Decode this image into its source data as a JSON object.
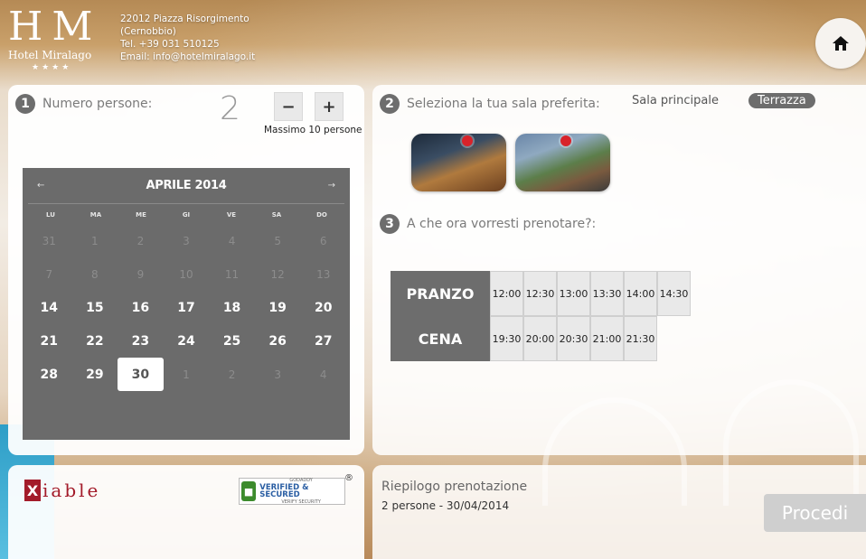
{
  "hotel": {
    "logo_mark": "H M",
    "logo_name": "Hotel Miralago",
    "logo_stars": "★★★★",
    "address_line1": "22012 Piazza Risorgimento",
    "address_line2": "(Cernobbio)",
    "phone": "Tel. +39 031 510125",
    "email": "Email: info@hotelmiralago.it"
  },
  "step1": {
    "number": "1",
    "label": "Numero persone:",
    "count": "2",
    "minus_label": "−",
    "plus_label": "+",
    "max_note": "Massimo 10 persone"
  },
  "calendar": {
    "prev_label": "←",
    "next_label": "→",
    "title": "APRILE 2014",
    "weekdays": [
      "LU",
      "MA",
      "ME",
      "GI",
      "VE",
      "SA",
      "DO"
    ],
    "days": [
      {
        "n": "31",
        "muted": true
      },
      {
        "n": "1",
        "muted": true
      },
      {
        "n": "2",
        "muted": true
      },
      {
        "n": "3",
        "muted": true
      },
      {
        "n": "4",
        "muted": true
      },
      {
        "n": "5",
        "muted": true
      },
      {
        "n": "6",
        "muted": true
      },
      {
        "n": "7",
        "muted": true
      },
      {
        "n": "8",
        "muted": true
      },
      {
        "n": "9",
        "muted": true
      },
      {
        "n": "10",
        "muted": true
      },
      {
        "n": "11",
        "muted": true
      },
      {
        "n": "12",
        "muted": true
      },
      {
        "n": "13",
        "muted": true
      },
      {
        "n": "14"
      },
      {
        "n": "15"
      },
      {
        "n": "16"
      },
      {
        "n": "17"
      },
      {
        "n": "18"
      },
      {
        "n": "19"
      },
      {
        "n": "20"
      },
      {
        "n": "21"
      },
      {
        "n": "22"
      },
      {
        "n": "23"
      },
      {
        "n": "24"
      },
      {
        "n": "25"
      },
      {
        "n": "26"
      },
      {
        "n": "27"
      },
      {
        "n": "28"
      },
      {
        "n": "29"
      },
      {
        "n": "30",
        "selected": true
      },
      {
        "n": "1",
        "muted": true
      },
      {
        "n": "2",
        "muted": true
      },
      {
        "n": "3",
        "muted": true
      },
      {
        "n": "4",
        "muted": true
      }
    ]
  },
  "step2": {
    "number": "2",
    "label": "Seleziona la tua sala preferita:",
    "room_main": "Sala principale",
    "room_terrace": "Terrazza"
  },
  "step3": {
    "number": "3",
    "label": "A che ora vorresti prenotare?:",
    "lunch_label": "PRANZO",
    "lunch_slots": [
      "12:00",
      "12:30",
      "13:00",
      "13:30",
      "14:00",
      "14:30"
    ],
    "dinner_label": "CENA",
    "dinner_slots": [
      "19:30",
      "20:00",
      "20:30",
      "21:00",
      "21:30"
    ]
  },
  "footer": {
    "xtable_box": "X",
    "xtable_text": "iable",
    "badge_line1": "GODADDY",
    "badge_line2": "VERIFIED & SECURED",
    "badge_line3": "VERIFY SECURITY",
    "badge_reg": "®",
    "summary_title": "Riepilogo prenotazione",
    "summary_text": "2 persone - 30/04/2014",
    "proceed_label": "Procedi"
  },
  "colors": {
    "panel_gray": "#6d6d6d",
    "calendar_bg": "#6b6b6b",
    "accent_red": "#a31b2a"
  }
}
